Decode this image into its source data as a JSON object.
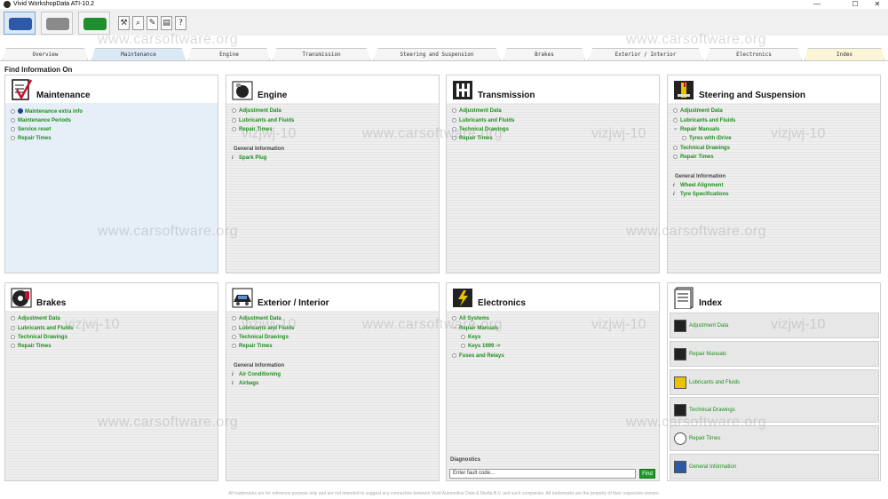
{
  "window": {
    "title": "Vivid WorkshopData ATI-10.2",
    "minimize": "—",
    "maximize": "☐",
    "close": "✕"
  },
  "tabs": [
    "Overview",
    "Maintenance",
    "Engine",
    "Transmission",
    "Steering and Suspension",
    "Brakes",
    "Exterior / Interior",
    "Electronics",
    "Index"
  ],
  "find_label": "Find Information On",
  "watermark": "www.carsoftware.org",
  "watermark2": "vizjwj-10",
  "colors": {
    "link_green": "#1f8f1f",
    "active_tab": "#dbe8f6",
    "index_tab": "#fbf6d6",
    "find_button": "#1f9a2a"
  },
  "panels": {
    "maintenance": {
      "title": "Maintenance",
      "items": [
        "Maintenance extra info",
        "Maintenance Periods",
        "Service reset",
        "Repair Times"
      ]
    },
    "engine": {
      "title": "Engine",
      "items": [
        "Adjustment Data",
        "Lubricants and Fluids",
        "Repair Times"
      ],
      "general_label": "General Information",
      "general_items": [
        "Spark Plug"
      ]
    },
    "transmission": {
      "title": "Transmission",
      "items": [
        "Adjustment Data",
        "Lubricants and Fluids",
        "Technical Drawings",
        "Repair Times"
      ]
    },
    "steering": {
      "title": "Steering and Suspension",
      "items": [
        "Adjustment Data",
        "Lubricants and Fluids",
        "Repair Manuals",
        "Tyres with iDrive",
        "Technical Drawings",
        "Repair Times"
      ],
      "general_label": "General Information",
      "general_items": [
        "Wheel Alignment",
        "Tyre Specifications"
      ]
    },
    "brakes": {
      "title": "Brakes",
      "items": [
        "Adjustment Data",
        "Lubricants and Fluids",
        "Technical Drawings",
        "Repair Times"
      ]
    },
    "exterior": {
      "title": "Exterior / Interior",
      "items": [
        "Adjustment Data",
        "Lubricants and Fluids",
        "Technical Drawings",
        "Repair Times"
      ],
      "general_label": "General Information",
      "general_items": [
        "Air Conditioning",
        "Airbags"
      ]
    },
    "electronics": {
      "title": "Electronics",
      "items": [
        "All Systems",
        "Repair Manuals",
        "Keys",
        "Keys 1999 ->",
        "Fuses and Relays"
      ],
      "diagnostics_label": "Diagnostics",
      "fault_placeholder": "Enter fault code...",
      "find_button": "Find"
    },
    "index": {
      "title": "Index",
      "items": [
        "Adjustment Data",
        "Repair Manuals",
        "Lubricants and Fluids",
        "Technical Drawings",
        "Repair Times",
        "General Information"
      ]
    }
  },
  "footer": "All trademarks are for reference purpose only and are not intended to suggest any connection between Vivid Automotive Data & Media B.V. and such companies. All trademarks are the property of their respective owners."
}
